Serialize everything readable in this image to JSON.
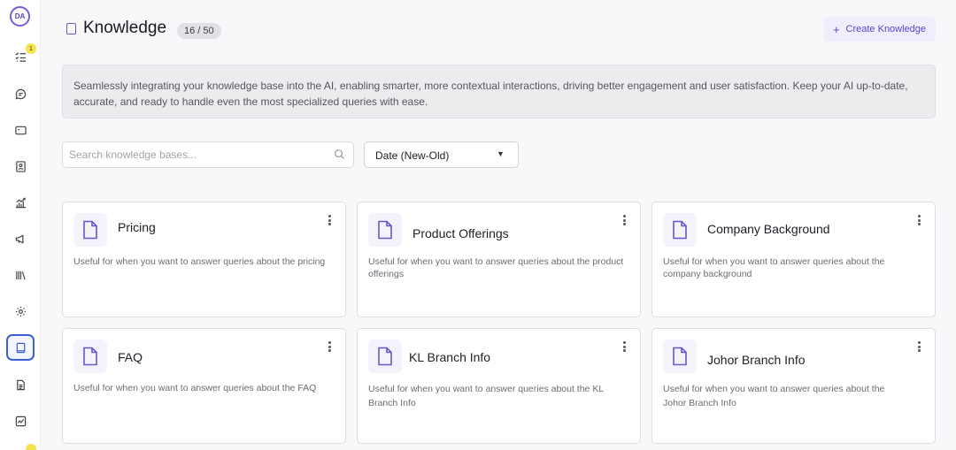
{
  "brand": {
    "logo_text": "DA"
  },
  "sidebar": {
    "items": [
      {
        "name": "tasks",
        "icon": "list-check-icon",
        "badge": "1"
      },
      {
        "name": "chat",
        "icon": "chat-bubble-icon"
      },
      {
        "name": "widget",
        "icon": "window-icon"
      },
      {
        "name": "contacts",
        "icon": "contact-book-icon"
      },
      {
        "name": "analytics",
        "icon": "trend-chart-icon"
      },
      {
        "name": "campaigns",
        "icon": "megaphone-icon"
      },
      {
        "name": "library",
        "icon": "books-icon"
      },
      {
        "name": "settings",
        "icon": "gear-icon"
      },
      {
        "name": "knowledge",
        "icon": "book-icon",
        "active": true
      },
      {
        "name": "documents",
        "icon": "document-icon"
      },
      {
        "name": "reports",
        "icon": "activity-chart-icon"
      }
    ]
  },
  "header": {
    "title": "Knowledge",
    "count": "16 / 50",
    "create_label": "Create Knowledge"
  },
  "info": {
    "text": "Seamlessly integrating your knowledge base into the AI, enabling smarter, more contextual interactions, driving better engagement and user satisfaction. Keep your AI up-to-date, accurate, and ready to handle even the most specialized queries with ease."
  },
  "search": {
    "placeholder": "Search knowledge bases..."
  },
  "sort": {
    "value": "Date (New-Old)"
  },
  "cards": [
    {
      "title": "Pricing",
      "description": "Useful for when you want to answer queries about the pricing"
    },
    {
      "title": "Product Offerings",
      "description": "Useful for when you want to answer queries about the product offerings"
    },
    {
      "title": "Company Background",
      "description": "Useful for when you want to answer queries about the company background"
    },
    {
      "title": "FAQ",
      "description": "Useful for when you want to answer queries about the FAQ"
    },
    {
      "title": "KL Branch Info",
      "description": "Useful for when you want to answer queries about the KL Branch Info"
    },
    {
      "title": "Johor Branch Info",
      "description": "Useful for when you want to answer queries about the Johor Branch Info"
    }
  ],
  "colors": {
    "accent": "#6b57c9",
    "active_nav": "#3c5fd6",
    "badge": "#f5e34a"
  }
}
